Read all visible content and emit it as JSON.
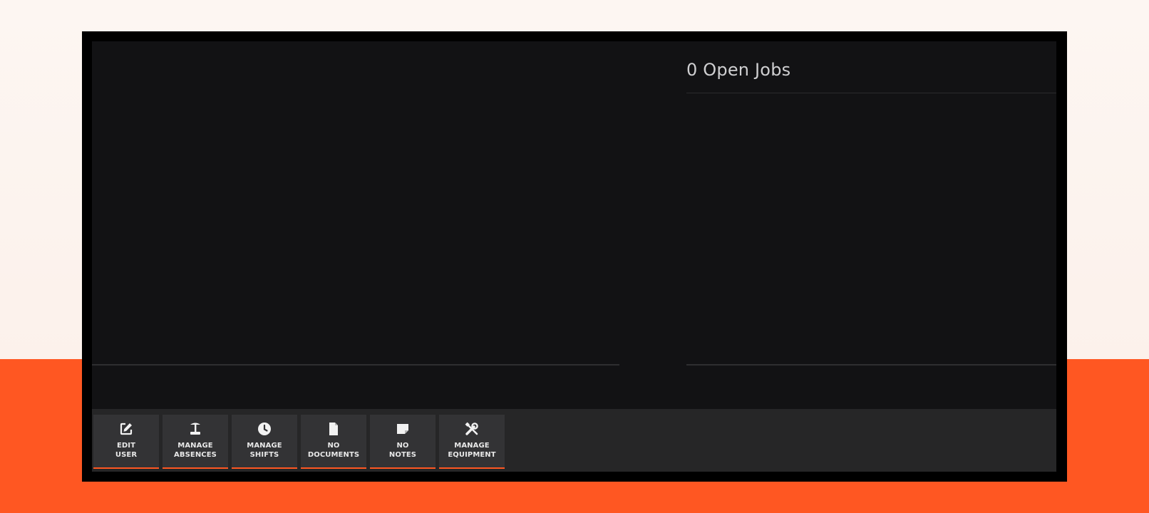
{
  "jobs_panel": {
    "title": "0 Open Jobs"
  },
  "toolbar": {
    "buttons": [
      {
        "line1": "EDIT",
        "line2": "USER",
        "icon": "edit-icon"
      },
      {
        "line1": "MANAGE",
        "line2": "ABSENCES",
        "icon": "beach-umbrella-icon"
      },
      {
        "line1": "MANAGE",
        "line2": "SHIFTS",
        "icon": "clock-icon"
      },
      {
        "line1": "NO",
        "line2": "DOCUMENTS",
        "icon": "document-icon"
      },
      {
        "line1": "NO",
        "line2": "NOTES",
        "icon": "note-icon"
      },
      {
        "line1": "MANAGE",
        "line2": "EQUIPMENT",
        "icon": "tools-icon"
      }
    ]
  },
  "colors": {
    "accent": "#ff5722",
    "screen_bg": "#121214",
    "toolbar_bg": "#262627",
    "button_bg": "#333335"
  }
}
